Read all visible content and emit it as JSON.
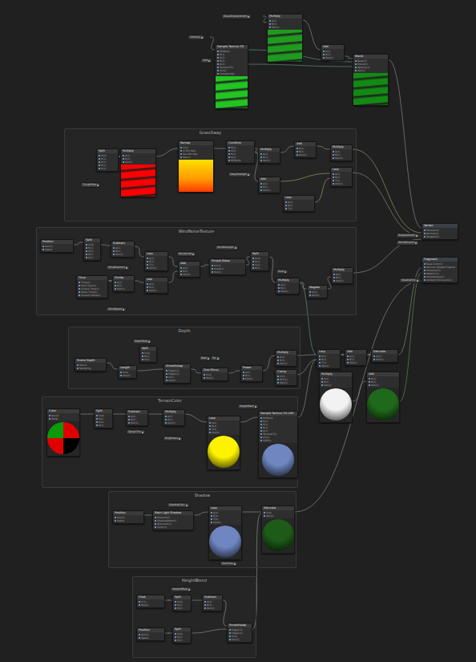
{
  "nodes": [
    {
      "title": "GrassDisplacement",
      "kind": "property"
    },
    {
      "title": "Multiply",
      "kind": "rect-preview",
      "color": "#1f9a1f",
      "ports": [
        "A(1)",
        "B(1)",
        "Out(1)"
      ]
    },
    {
      "title": "Intensity",
      "kind": "property"
    },
    {
      "title": "Sample Texture 2D",
      "kind": "rect-preview",
      "color": "#22c422",
      "ports": [
        "RGBA(4)",
        "R(1)",
        "G(1)",
        "B(1)",
        "A(1)",
        "Texture(T2)",
        "UV(2)",
        "Sampler(SS)"
      ]
    },
    {
      "title": "UV0",
      "kind": "property"
    },
    {
      "title": "Add",
      "kind": "node",
      "ports": [
        "A(1)",
        "B(1)",
        "Out(1)"
      ]
    },
    {
      "title": "Blend",
      "kind": "rect-preview",
      "color": "#138a13",
      "ports": [
        "Base(3)",
        "Blend(3)",
        "Opacity(1)",
        "Out(3)"
      ]
    },
    {
      "title": "Vertex",
      "kind": "stack",
      "ports": [
        "Position(3)",
        "Normal(3)",
        "Tangent(3)"
      ]
    },
    {
      "title": "Fragment",
      "kind": "stack",
      "ports": [
        "Base Color(3)",
        "Normal (Tangent Space)",
        "Emission(3)",
        "Metallic(1)",
        "Smoothness(1)",
        "Ambient Occlusion(1)"
      ]
    },
    {
      "title": "Displacement",
      "kind": "property"
    },
    {
      "title": "WorldPosition",
      "kind": "property"
    },
    {
      "title": "ShadowTint",
      "kind": "property"
    },
    {
      "title": "Lerp",
      "kind": "node",
      "ports": [
        "A(1)",
        "B(1)",
        "T(1)",
        "Out(1)"
      ]
    },
    {
      "title": "Add",
      "kind": "node",
      "ports": [
        "A(1)",
        "B(1)",
        "Out(1)"
      ]
    },
    {
      "title": "Saturate",
      "kind": "node",
      "ports": [
        "In(1)",
        "Out(1)"
      ]
    },
    {
      "title": "Multiply",
      "kind": "sphere-preview",
      "color": "#f2f2f2",
      "ports": [
        "A(1)",
        "B(1)",
        "Out(1)"
      ]
    },
    {
      "title": "Add",
      "kind": "sphere-preview",
      "color": "#1f6a1a",
      "ports": [
        "A(3)",
        "B(3)",
        "Out(3)"
      ]
    }
  ],
  "groups": [
    {
      "title": "GrassSway",
      "nodes": [
        {
          "title": "TilingOffset",
          "kind": "property"
        },
        {
          "title": "Split",
          "kind": "node",
          "ports": [
            "In(4)",
            "R(1)",
            "G(1)",
            "B(1)",
            "A(1)"
          ]
        },
        {
          "title": "Multiply",
          "kind": "rect-preview",
          "color": "#ff0000",
          "ports": [
            "A(1)",
            "B(1)",
            "Out(1)"
          ]
        },
        {
          "title": "Remap",
          "kind": "gradient-preview",
          "color": "#ffe000",
          "ports": [
            "In(1)",
            "In Min Max",
            "Out Min Max",
            "Out(1)"
          ]
        },
        {
          "title": "Combine",
          "kind": "node",
          "ports": [
            "R(1)",
            "G(1)",
            "B(1)",
            "A(1)",
            "RGBA(4)"
          ]
        },
        {
          "title": "Multiply",
          "kind": "node",
          "ports": [
            "A(1)",
            "B(1)",
            "Out(1)"
          ]
        },
        {
          "title": "SwayStrength",
          "kind": "property"
        },
        {
          "title": "Add",
          "kind": "node",
          "ports": [
            "A(1)",
            "B(1)",
            "Out(1)"
          ]
        },
        {
          "title": "Add",
          "kind": "node",
          "ports": [
            "A(1)",
            "B(1)",
            "Out(1)"
          ]
        },
        {
          "title": "Multiply",
          "kind": "node",
          "ports": [
            "A(1)",
            "B(1)",
            "Out(1)"
          ]
        },
        {
          "title": "Lerp",
          "kind": "node",
          "ports": [
            "A(1)",
            "B(1)",
            "T(1)",
            "Out(1)"
          ]
        },
        {
          "title": "Lerp",
          "kind": "node",
          "ports": [
            "A(1)",
            "B(1)",
            "T(1)"
          ]
        }
      ]
    },
    {
      "title": "WindNoiseTexture",
      "nodes": [
        {
          "title": "Position",
          "kind": "node",
          "ports": [
            "Out(3)",
            "Space"
          ]
        },
        {
          "title": "Split",
          "kind": "node",
          "ports": [
            "In(4)",
            "R(1)",
            "G(1)",
            "B(1)",
            "A(1)"
          ]
        },
        {
          "title": "Subtract",
          "kind": "node",
          "ports": [
            "A(1)",
            "B(1)",
            "Out(1)"
          ]
        },
        {
          "title": "WindDirection",
          "kind": "property"
        },
        {
          "title": "Time",
          "kind": "node",
          "ports": [
            "Time(1)",
            "Sine Time(1)",
            "Cosine Time(1)",
            "Delta Time(1)",
            "Smooth Delta(1)"
          ]
        },
        {
          "title": "Divide",
          "kind": "node",
          "ports": [
            "A(1)",
            "B(1)",
            "Out(1)"
          ]
        },
        {
          "title": "WindSpeed",
          "kind": "property"
        },
        {
          "title": "Lerp",
          "kind": "node",
          "ports": [
            "A(1)",
            "B(1)",
            "T(1)",
            "Out(1)"
          ]
        },
        {
          "title": "Add",
          "kind": "node",
          "ports": [
            "A(1)",
            "B(1)",
            "Out(1)"
          ]
        },
        {
          "title": "Add",
          "kind": "node",
          "ports": [
            "A(2)",
            "B(2)",
            "Out(2)"
          ]
        },
        {
          "title": "NoiseScale",
          "kind": "property"
        },
        {
          "title": "Simple Noise",
          "kind": "node",
          "ports": [
            "UV(2)",
            "Scale(1)",
            "Out(1)"
          ]
        },
        {
          "title": "WindStrength",
          "kind": "property"
        },
        {
          "title": "Split",
          "kind": "node",
          "ports": [
            "In(4)",
            "R(1)",
            "G(1)",
            "B(1)"
          ]
        },
        {
          "title": "Gust",
          "kind": "property"
        },
        {
          "title": "Multiply",
          "kind": "node",
          "ports": [
            "A(1)",
            "B(1)",
            "Out(1)"
          ]
        },
        {
          "title": "Negate",
          "kind": "node",
          "ports": [
            "In(1)",
            "Out(1)"
          ]
        },
        {
          "title": "Multiply",
          "kind": "node",
          "ports": [
            "A(1)",
            "B(1)",
            "Out(1)"
          ]
        }
      ]
    },
    {
      "title": "Depth",
      "nodes": [
        {
          "title": "DepthFade",
          "kind": "property"
        },
        {
          "title": "Split",
          "kind": "node",
          "ports": [
            "In(4)",
            "R(1)",
            "G(1)"
          ]
        },
        {
          "title": "Scene Depth",
          "kind": "node",
          "ports": [
            "Out(1)",
            "Sampling"
          ]
        },
        {
          "title": "Length",
          "kind": "node",
          "ports": [
            "In(3)",
            "Out(1)"
          ]
        },
        {
          "title": "Smoothstep",
          "kind": "node",
          "ports": [
            "Edge1(1)",
            "Edge2(1)",
            "In(1)",
            "Out(1)"
          ]
        },
        {
          "title": "Near",
          "kind": "property"
        },
        {
          "title": "Far",
          "kind": "property"
        },
        {
          "title": "One Minus",
          "kind": "node",
          "ports": [
            "In(1)",
            "Out(1)"
          ]
        },
        {
          "title": "Power",
          "kind": "node",
          "ports": [
            "A(1)",
            "B(1)",
            "Out(1)"
          ]
        },
        {
          "title": "Multiply",
          "kind": "node",
          "ports": [
            "A(1)",
            "B(1)",
            "Out(1)"
          ]
        },
        {
          "title": "Clamp",
          "kind": "node",
          "ports": [
            "In(1)",
            "Min(1)",
            "Max(1)"
          ]
        }
      ]
    },
    {
      "title": "TerrainColor",
      "nodes": [
        {
          "title": "Color",
          "kind": "quad-preview",
          "color": "#e00000",
          "ports": [
            "Out(4)",
            "Mode"
          ]
        },
        {
          "title": "Split",
          "kind": "node",
          "ports": [
            "In(4)",
            "R(1)",
            "G(1)",
            "B(1)"
          ]
        },
        {
          "title": "Subtract",
          "kind": "node",
          "ports": [
            "A(1)",
            "B(1)",
            "Out(1)"
          ]
        },
        {
          "title": "TerrainTint",
          "kind": "property"
        },
        {
          "title": "Multiply",
          "kind": "node",
          "ports": [
            "A(1)",
            "B(1)",
            "Out(1)"
          ]
        },
        {
          "title": "Brightness",
          "kind": "property"
        },
        {
          "title": "Lerp",
          "kind": "sphere-preview",
          "color": "#fff200",
          "ports": [
            "A(4)",
            "B(4)",
            "T(4)",
            "Out(4)"
          ]
        },
        {
          "title": "HeightMask",
          "kind": "property"
        },
        {
          "title": "Sample Texture 2D LOD",
          "kind": "sphere-preview",
          "color": "#6f86c0",
          "ports": [
            "RGBA(4)",
            "R(1)",
            "G(1)",
            "B(1)",
            "A(1)",
            "Texture(T2)",
            "UV(2)",
            "LOD(1)"
          ]
        }
      ]
    },
    {
      "title": "Shadow",
      "nodes": [
        {
          "title": "ShadowColor",
          "kind": "property"
        },
        {
          "title": "Position",
          "kind": "node",
          "ports": [
            "Out(3)",
            "Space"
          ]
        },
        {
          "title": "Main Light Shadow",
          "kind": "node",
          "ports": [
            "Position(3)",
            "ShadowAtten(1)",
            "Direction(3)",
            "Color(3)"
          ]
        },
        {
          "title": "Lerp",
          "kind": "sphere-preview",
          "color": "#6f86c0",
          "ports": [
            "A(4)",
            "B(4)",
            "T(4)",
            "Out(4)"
          ]
        },
        {
          "title": "Darkness",
          "kind": "property"
        },
        {
          "title": "Saturate",
          "kind": "sphere-preview",
          "color": "#1e5a18",
          "ports": [
            "In(4)",
            "Out(4)"
          ]
        }
      ]
    },
    {
      "title": "HeightBlend",
      "nodes": [
        {
          "title": "HeightOffset",
          "kind": "property"
        },
        {
          "title": "Float",
          "kind": "node",
          "ports": [
            "X(1)",
            "Out(1)"
          ]
        },
        {
          "title": "Split",
          "kind": "node",
          "ports": [
            "In(4)",
            "R(1)",
            "G(1)"
          ]
        },
        {
          "title": "Subtract",
          "kind": "node",
          "ports": [
            "A(1)",
            "B(1)",
            "Out(1)"
          ]
        },
        {
          "title": "Position",
          "kind": "node",
          "ports": [
            "Out(3)",
            "Space"
          ]
        },
        {
          "title": "Split",
          "kind": "node",
          "ports": [
            "In(4)",
            "R(1)",
            "G(1)"
          ]
        },
        {
          "title": "Smoothstep",
          "kind": "node",
          "ports": [
            "Edge1(1)",
            "Edge2(1)",
            "In(1)",
            "Out(1)"
          ]
        }
      ]
    }
  ]
}
